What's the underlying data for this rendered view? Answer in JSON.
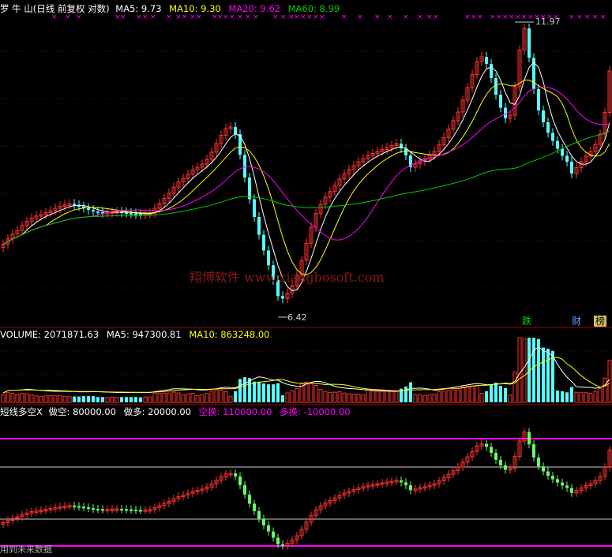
{
  "price_panel": {
    "title": "罗 牛 山(日线 前复权 对数)",
    "ma5_label": "MA5: 9.73",
    "ma10_label": "MA10: 9.30",
    "ma20_label": "MA20: 9.62",
    "ma60_label": "MA60: 8.99",
    "high_marker": "11.97",
    "low_marker": "6.42",
    "watermark": "翔博软件  www.xiangbosoft.com",
    "badges": [
      "跌",
      "财",
      "榜"
    ]
  },
  "volume_panel": {
    "volume_label": "VOLUME: 2071871.63",
    "ma5_label": "MA5: 947300.81",
    "ma10_label": "MA10: 863248.00"
  },
  "indicator_panel": {
    "title": "短线多空X",
    "zuokong_label": "做空: 80000.00",
    "zuoduo_label": "做多: 20000.00",
    "kongchuan_label": "空换: 110000.00",
    "duohuan_label": "多换: -10000.00",
    "footer": "用到未来数据"
  },
  "colors": {
    "up": "#ff3232",
    "down": "#54ffff",
    "ma5": "#ffffff",
    "ma10": "#ffff00",
    "ma20": "#ff00ff",
    "ma60": "#00cc00",
    "grid": "#7a0000"
  }
}
